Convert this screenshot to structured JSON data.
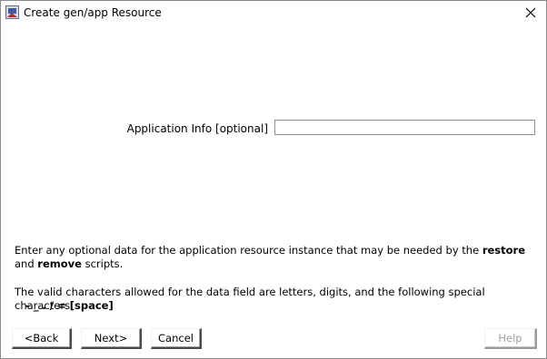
{
  "window": {
    "title": "Create gen/app Resource",
    "icon": "app-icon",
    "close_icon": "close-icon"
  },
  "form": {
    "label": "Application Info [optional]",
    "value": ""
  },
  "description": {
    "part1": "Enter any optional data for the application resource instance that may be needed by the ",
    "bold1": "restore",
    "part2": " and ",
    "bold2": "remove",
    "part3": " scripts.",
    "valid_chars": "The valid characters allowed for the data field are letters, digits, and the following special characters:",
    "special_chars": "- _ . / = [space]"
  },
  "buttons": {
    "back": "<Back",
    "next": "Next>",
    "cancel": "Cancel",
    "help": "Help"
  },
  "colors": {
    "background": "#ffffff",
    "border": "#8a8a8a",
    "disabled_text": "#a0a0a0"
  }
}
